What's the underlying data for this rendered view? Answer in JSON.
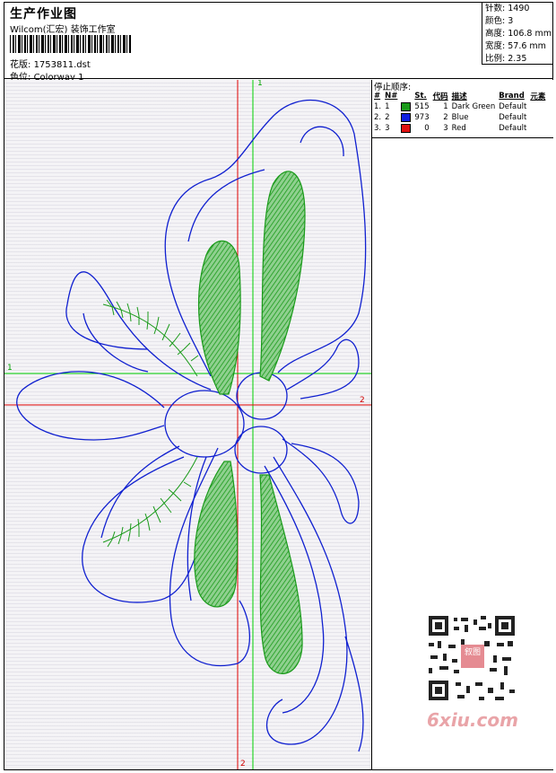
{
  "header": {
    "title": "生产作业图",
    "company": "Wilcom(汇宏) 装饰工作室",
    "file_label": "花版:",
    "file_name": "1753811.dst",
    "colorway_label": "色位:",
    "colorway_name": "Colorway 1"
  },
  "stats": [
    {
      "label": "针数:",
      "value": "1490"
    },
    {
      "label": "颜色:",
      "value": "3"
    },
    {
      "label": "高度:",
      "value": "106.8 mm"
    },
    {
      "label": "宽度:",
      "value": "57.6 mm"
    },
    {
      "label": "比例:",
      "value": "2.35"
    }
  ],
  "stop_sequence": {
    "title": "停止顺序:",
    "columns": [
      "#",
      "N#",
      "St.",
      "代码",
      "描述",
      "Brand",
      "元素"
    ],
    "rows": [
      {
        "idx": "1.",
        "n": "1",
        "color": "#1a9a1a",
        "st": "515",
        "code": "1",
        "desc": "Dark Green",
        "brand": "Default"
      },
      {
        "idx": "2.",
        "n": "2",
        "color": "#1020e0",
        "st": "973",
        "code": "2",
        "desc": "Blue",
        "brand": "Default"
      },
      {
        "idx": "3.",
        "n": "3",
        "color": "#e01010",
        "st": "0",
        "code": "3",
        "desc": "Red",
        "brand": "Default"
      }
    ]
  },
  "axes": {
    "green_top": "1",
    "green_left": "1",
    "red_right": "2",
    "red_bottom": "2"
  },
  "colors": {
    "outline": "#1020d0",
    "fill": "#1a9a1a",
    "guide_green": "#00d000",
    "guide_red": "#e00000"
  },
  "watermark": {
    "text": "6xiu.com",
    "badge": "叙图"
  }
}
